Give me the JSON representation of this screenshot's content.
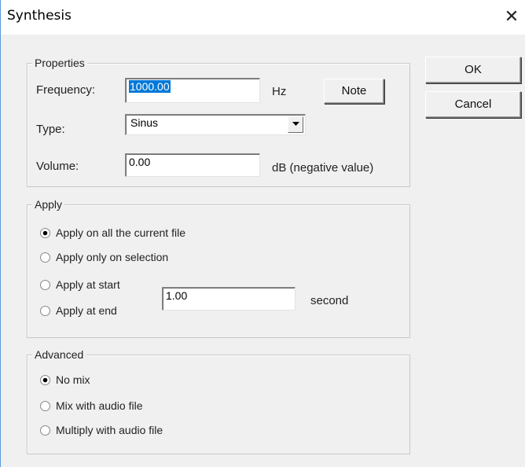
{
  "window": {
    "title": "Synthesis",
    "close_glyph": "✕"
  },
  "buttons": {
    "ok": "OK",
    "cancel": "Cancel",
    "note": "Note"
  },
  "properties": {
    "legend": "Properties",
    "frequency_label": "Frequency:",
    "frequency_value": "1000.00",
    "frequency_unit": "Hz",
    "type_label": "Type:",
    "type_value": "Sinus",
    "volume_label": "Volume:",
    "volume_value": "0.00",
    "volume_unit": "dB (negative value)"
  },
  "apply": {
    "legend": "Apply",
    "options": [
      {
        "label": "Apply on all the current file",
        "checked": true
      },
      {
        "label": "Apply only on selection",
        "checked": false
      },
      {
        "label": "Apply at start",
        "checked": false
      },
      {
        "label": "Apply at end",
        "checked": false
      }
    ],
    "seconds_value": "1.00",
    "seconds_unit": "second"
  },
  "advanced": {
    "legend": "Advanced",
    "options": [
      {
        "label": "No mix",
        "checked": true
      },
      {
        "label": "Mix with audio file",
        "checked": false
      },
      {
        "label": "Multiply with audio file",
        "checked": false
      }
    ]
  },
  "icons": {
    "close": "close-icon",
    "dropdown": "chevron-down-icon"
  },
  "colors": {
    "selection": "#0078d7",
    "window_border": "#5b9bd5",
    "face": "#f0f0f0"
  }
}
